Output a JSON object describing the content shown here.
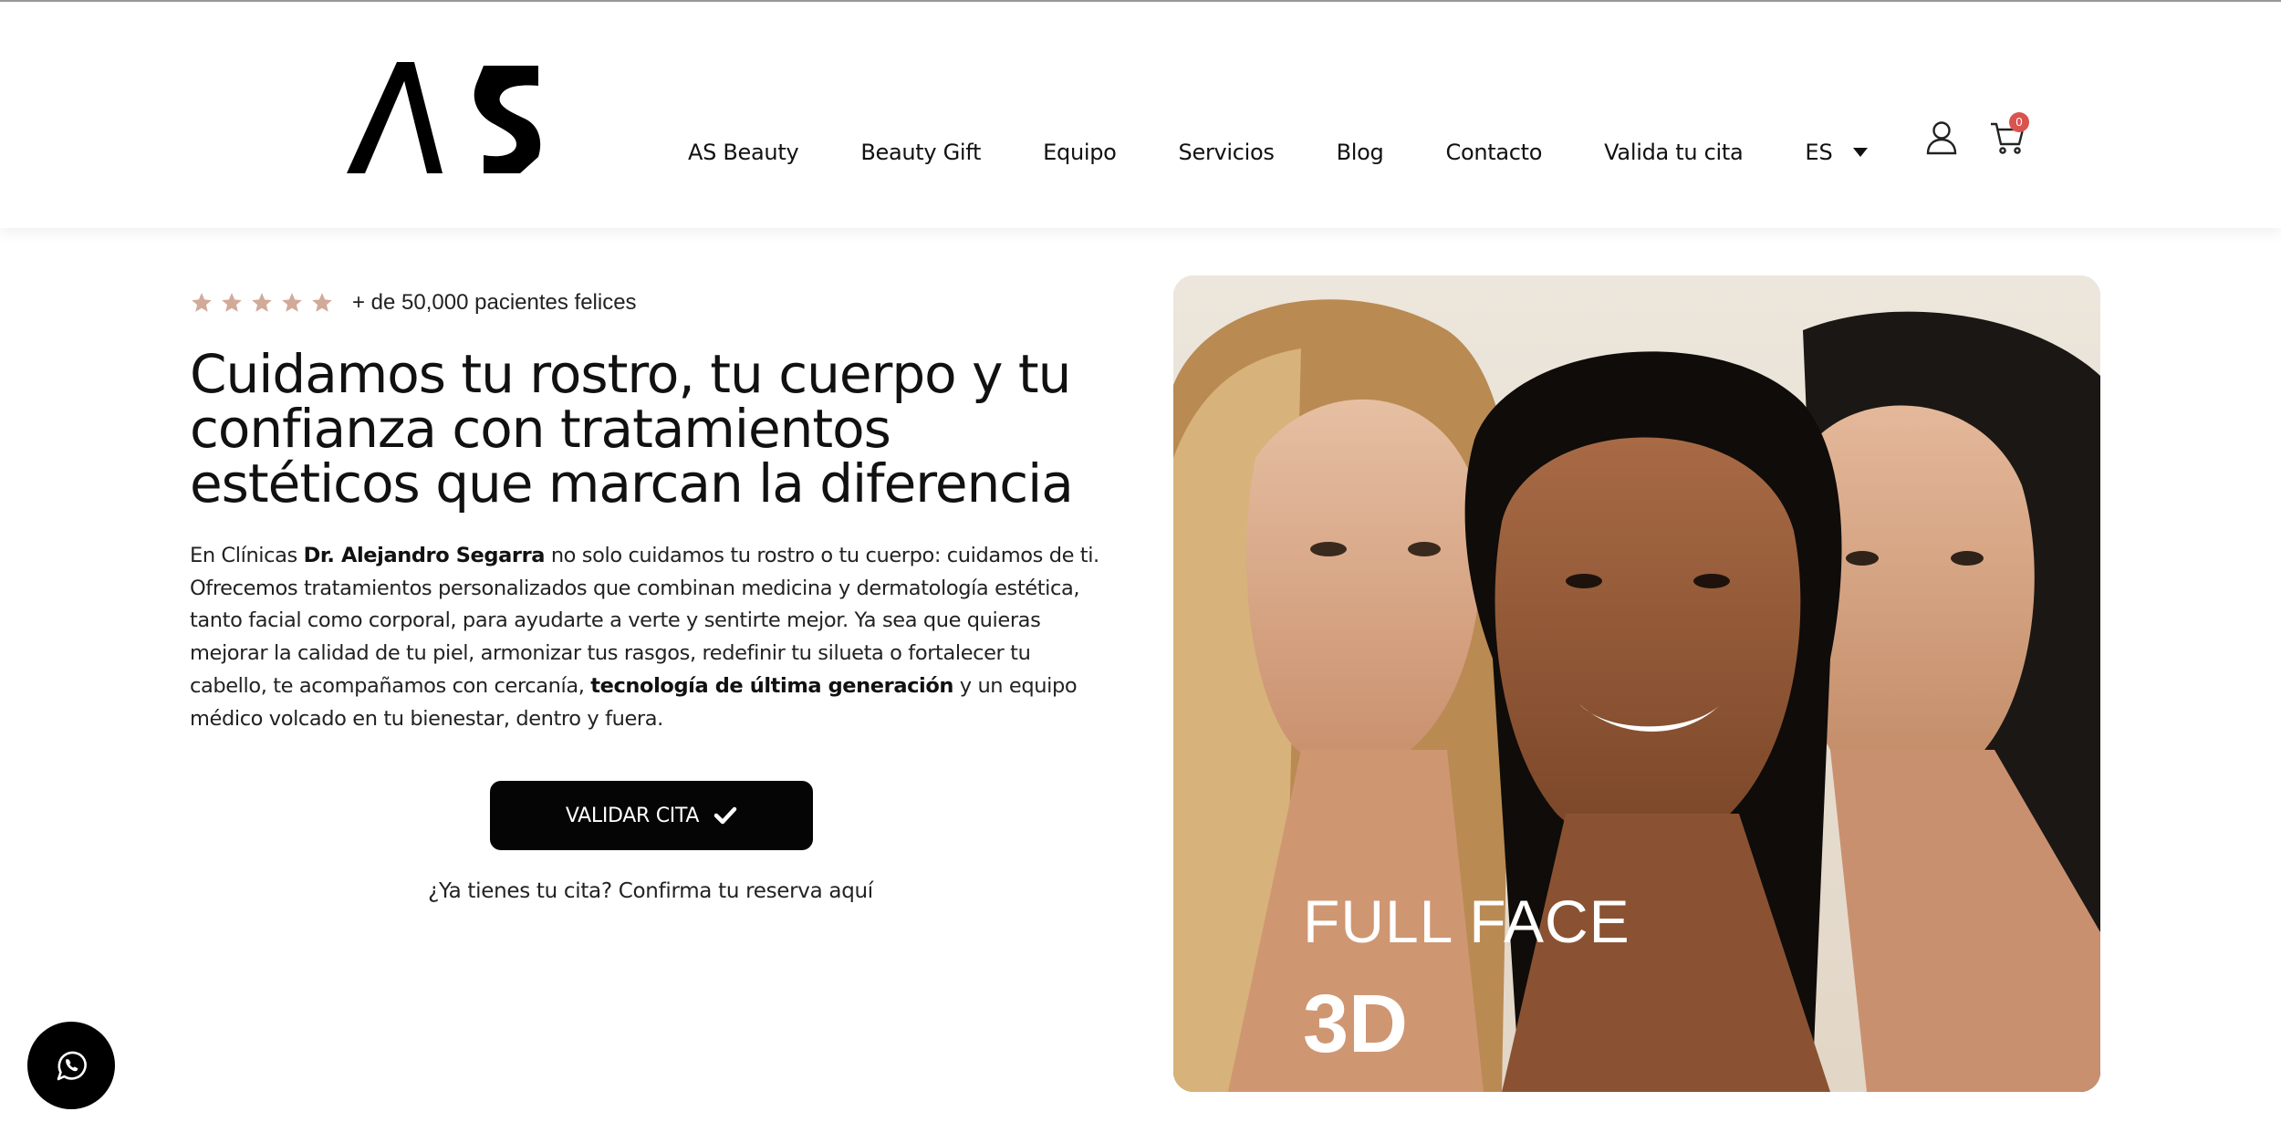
{
  "header": {
    "logo_text": "AS",
    "nav": [
      "AS Beauty",
      "Beauty Gift",
      "Equipo",
      "Servicios",
      "Blog",
      "Contacto",
      "Valida tu cita"
    ],
    "language": "ES",
    "cart_count": "0"
  },
  "hero": {
    "rating": {
      "stars": 5,
      "text": "+ de 50,000 pacientes felices"
    },
    "headline": "Cuidamos tu rostro, tu cuerpo y tu confianza con tratamientos estéticos que marcan la diferencia",
    "description": {
      "p1": "En Clínicas ",
      "b1": "Dr. Alejandro Segarra",
      "p2": " no solo cuidamos tu rostro o tu cuerpo: cuidamos de ti. Ofrecemos tratamientos personalizados que combinan medicina y dermatología estética, tanto facial como corporal, para ayudarte a verte y sentirte mejor. Ya sea que quieras mejorar la calidad de tu piel, armonizar tus rasgos, redefinir tu silueta o fortalecer tu cabello, te acompañamos con cercanía, ",
      "b2": "tecnología de última generación",
      "p3": " y un equipo médico volcado en tu bienestar, dentro y fuera."
    },
    "cta_label": "VALIDAR CITA",
    "confirm_text": "¿Ya tienes tu cita? Confirma tu reserva aquí",
    "image_overlay": {
      "line1": "FULL FACE",
      "line2": "3D"
    }
  },
  "colors": {
    "star": "#d2aa9a",
    "cta_bg": "#050505",
    "badge": "#d9534f"
  },
  "icons": [
    "user-icon",
    "cart-icon",
    "check-icon",
    "whatsapp-icon",
    "star-icon",
    "chevron-down-icon"
  ]
}
